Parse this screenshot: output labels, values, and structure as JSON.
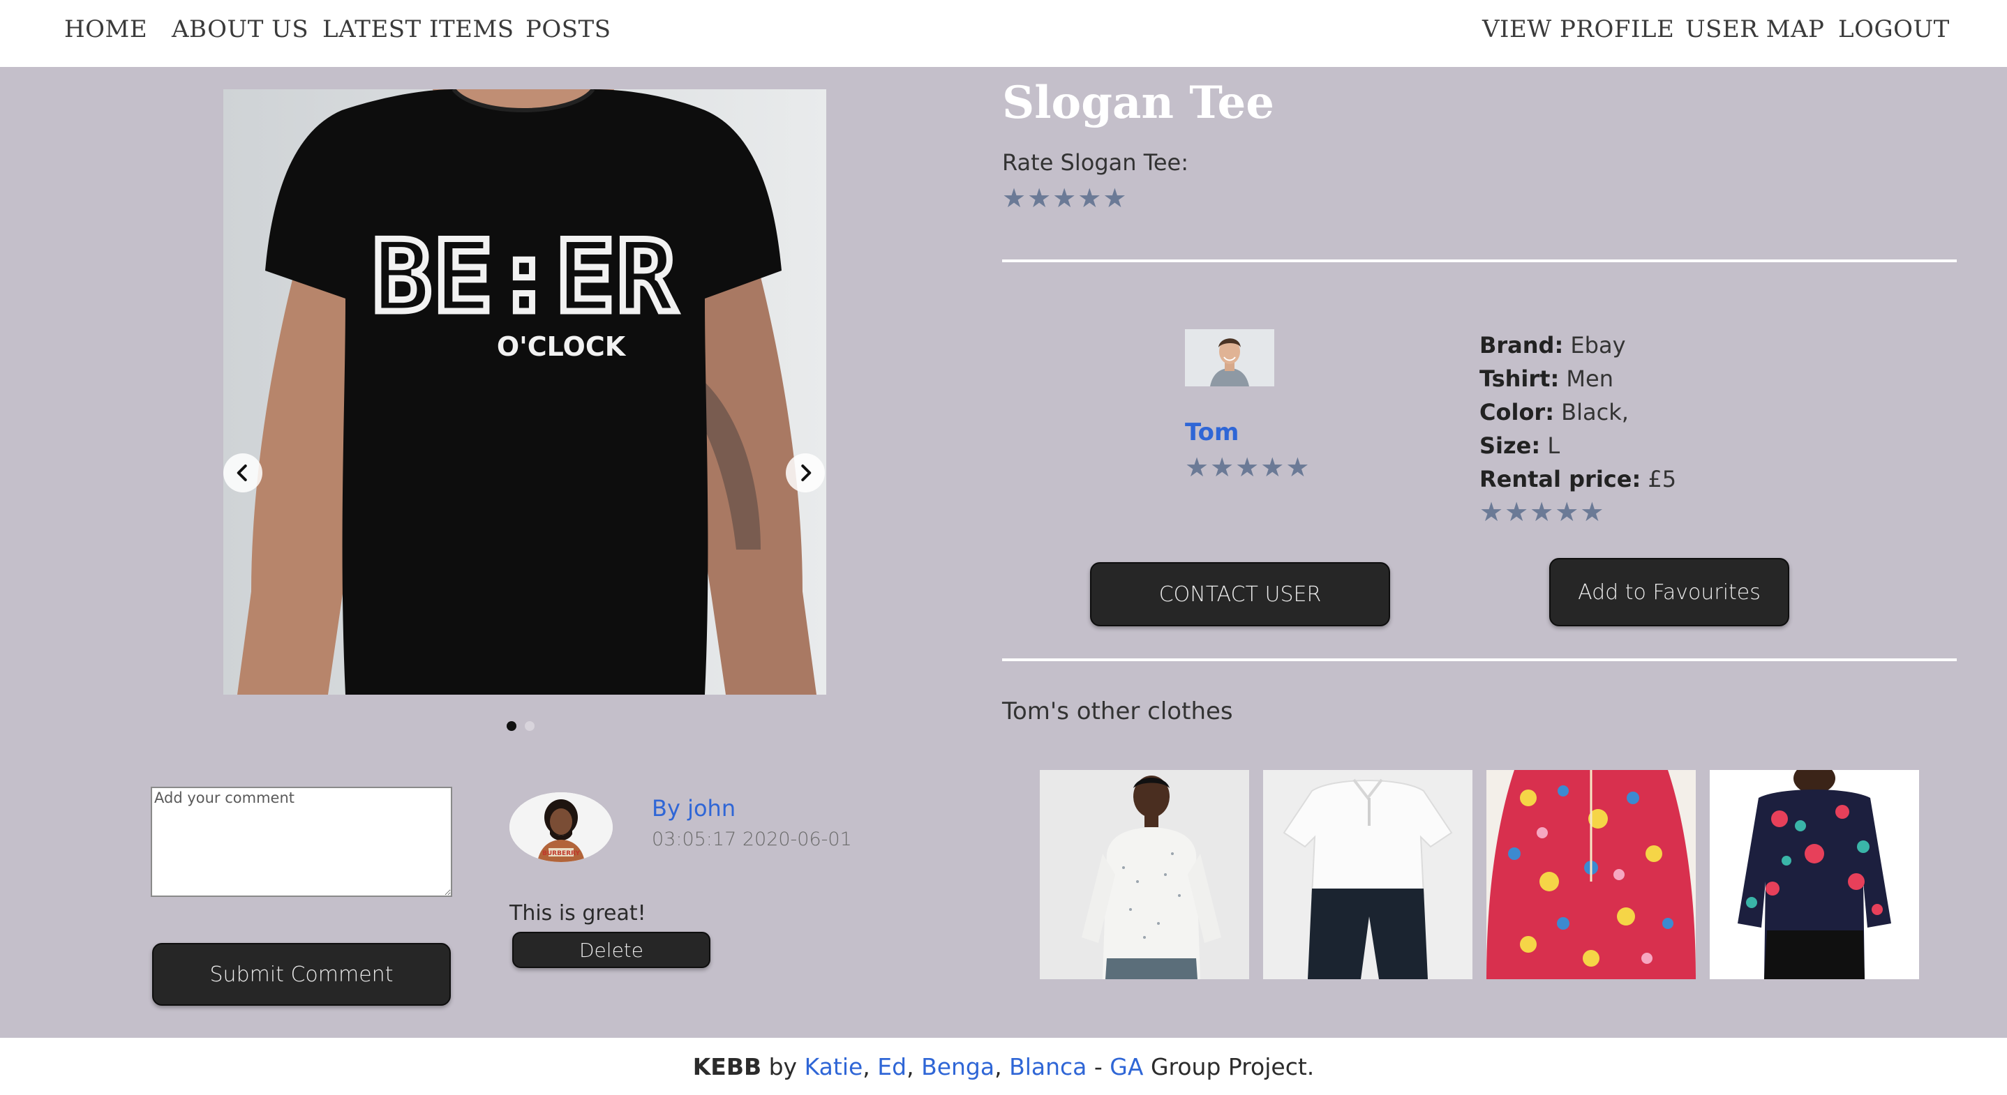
{
  "nav": {
    "left": [
      "HOME",
      "ABOUT US",
      "LATEST ITEMS",
      "POSTS"
    ],
    "right": [
      "VIEW PROFILE",
      "USER MAP",
      "LOGOUT"
    ]
  },
  "item": {
    "title": "Slogan Tee",
    "rate_label": "Rate Slogan Tee:",
    "shirt_print_line1": "BE:ER",
    "shirt_print_line2": "O'CLOCK",
    "carousel_slide_count": 2,
    "carousel_active_index": 0
  },
  "owner": {
    "name": "Tom",
    "rating_stars": 5
  },
  "details": {
    "brand_label": "Brand:",
    "brand_value": "Ebay",
    "tshirt_label": "Tshirt:",
    "tshirt_value": "Men",
    "color_label": "Color:",
    "color_value": "Black,",
    "size_label": "Size:",
    "size_value": "L",
    "price_label": "Rental price:",
    "price_value": "£5",
    "rating_stars": 5
  },
  "buttons": {
    "contact": "CONTACT USER",
    "favourite": "Add to Favourites",
    "submit_comment": "Submit Comment",
    "delete": "Delete"
  },
  "comment_form": {
    "placeholder": "Add your comment"
  },
  "comment": {
    "author": "By john",
    "timestamp": "03:05:17 2020-06-01",
    "text": "This is great!"
  },
  "other_clothes": {
    "heading": "Tom's other clothes"
  },
  "footer": {
    "brand": "KEBB",
    "by": " by ",
    "author1": "Katie",
    "sep1": ", ",
    "author2": "Ed",
    "sep2": ", ",
    "author3": "Benga",
    "sep3": ", ",
    "author4": "Blanca",
    "dash": " - ",
    "org": "GA",
    "suffix": " Group Project."
  },
  "colors": {
    "page_bg": "#c4bfca",
    "link": "#2f66d6",
    "star": "#6b7a96",
    "button_bg": "#262626"
  }
}
